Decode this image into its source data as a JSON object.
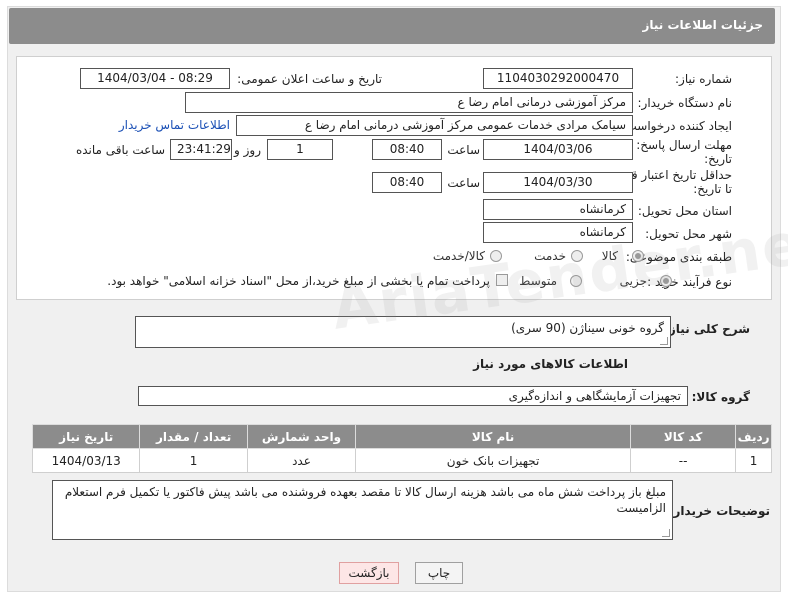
{
  "header": {
    "title": "جزئیات اطلاعات نیاز"
  },
  "labels": {
    "need_number": "شماره نیاز:",
    "announce_datetime": "تاریخ و ساعت اعلان عمومی:",
    "buyer_org": "نام دستگاه خریدار:",
    "requester": "ایجاد کننده درخواست:",
    "reply_deadline_1": "مهلت ارسال پاسخ: تا",
    "reply_deadline_2": "تاریخ:",
    "hour": "ساعت",
    "day_and": "روز و",
    "remaining": "ساعت باقی مانده",
    "price_deadline_1": "حداقل تاریخ اعتبار قیمت:",
    "price_deadline_2": "تا تاریخ:",
    "hour2": "ساعت",
    "province": "استان محل تحویل:",
    "city": "شهر محل تحویل:",
    "category": "طبقه بندی موضوعی:",
    "purchase_type": "نوع فرآیند خرید :",
    "description": "شرح کلی نیاز:",
    "goods_info": "اطلاعات کالاهای مورد نیاز",
    "goods_group": "گروه کالا:",
    "buyer_notes": "توضیحات خریدار:"
  },
  "values": {
    "need_number": "1104030292000470",
    "announce_datetime": "1404/03/04 - 08:29",
    "buyer_org": "مرکز آموزشی  درمانی امام رضا  ع",
    "requester": "سیامک مرادی خدمات عمومی مرکز آموزشی  درمانی امام رضا  ع",
    "contact_link": "اطلاعات تماس خریدار",
    "reply_date": "1404/03/06",
    "reply_time": "08:40",
    "reply_days": "1",
    "reply_remaining": "23:41:29",
    "price_date": "1404/03/30",
    "price_time": "08:40",
    "province": "کرمانشاه",
    "city": "کرمانشاه",
    "description": "گروه خونی سیناژن (90 سری)",
    "goods_group": "تجهیزات آزمایشگاهی و اندازه‌گیری",
    "buyer_notes": "مبلغ باز پرداخت شش ماه می باشد هزینه ارسال کالا تا مقصد بعهده فروشنده می باشد پیش فاکتور یا تکمیل فرم استعلام الزامیست"
  },
  "category_options": [
    "کالا",
    "خدمت",
    "کالا/خدمت"
  ],
  "purchase_options": [
    "جزیی",
    "متوسط"
  ],
  "payment_note": "پرداخت تمام یا بخشی از مبلغ خرید،از محل \"اسناد خزانه اسلامی\" خواهد بود.",
  "table": {
    "headers": [
      "ردیف",
      "کد کالا",
      "نام کالا",
      "واحد شمارش",
      "تعداد / مقدار",
      "تاریخ نیاز"
    ],
    "rows": [
      [
        "1",
        "--",
        "تجهیزات بانک خون",
        "عدد",
        "1",
        "1404/03/13"
      ]
    ]
  },
  "buttons": {
    "print": "چاپ",
    "back": "بازگشت"
  },
  "watermark": "AriaTender.net"
}
